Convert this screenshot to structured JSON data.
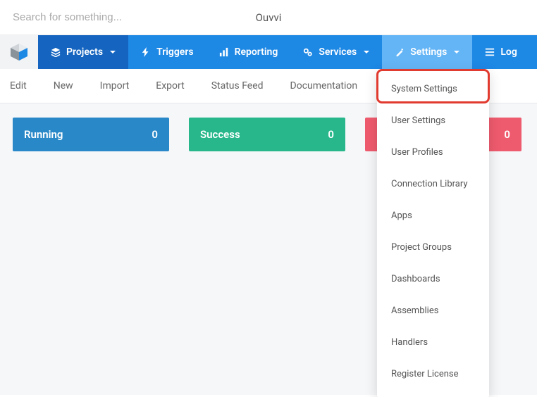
{
  "topbar": {
    "search_placeholder": "Search for something...",
    "app_title": "Ouvvi"
  },
  "nav": {
    "projects": "Projects",
    "triggers": "Triggers",
    "reporting": "Reporting",
    "services": "Services",
    "settings": "Settings",
    "log": "Log"
  },
  "subnav": {
    "edit": "Edit",
    "new": "New",
    "import": "Import",
    "export": "Export",
    "status_feed": "Status Feed",
    "documentation": "Documentation"
  },
  "stats": {
    "running": {
      "label": "Running",
      "value": "0"
    },
    "success": {
      "label": "Success",
      "value": "0"
    },
    "error": {
      "label": "",
      "value": "0"
    }
  },
  "settings_menu": {
    "system_settings": "System Settings",
    "user_settings": "User Settings",
    "user_profiles": "User Profiles",
    "connection_library": "Connection Library",
    "apps": "Apps",
    "project_groups": "Project Groups",
    "dashboards": "Dashboards",
    "assemblies": "Assemblies",
    "handlers": "Handlers",
    "register_license": "Register License"
  }
}
